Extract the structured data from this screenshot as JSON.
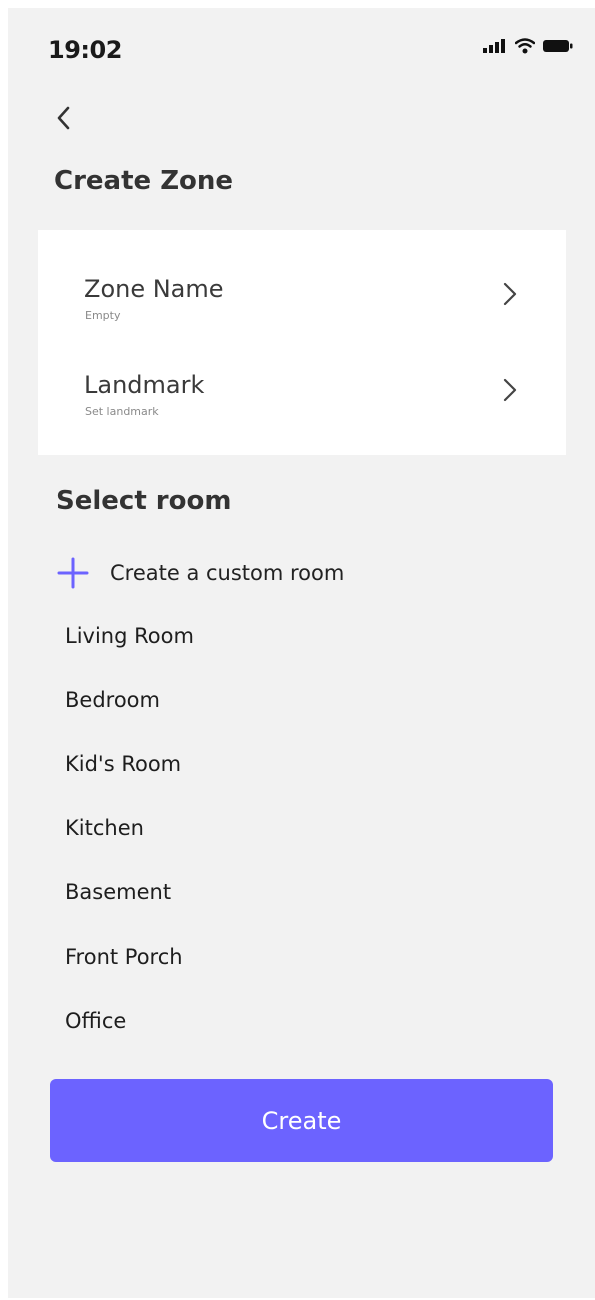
{
  "status_bar": {
    "time": "19:02",
    "icons": [
      "signal-icon",
      "wifi-icon",
      "battery-icon"
    ]
  },
  "header": {
    "back_icon": "chevron-left-icon",
    "title": "Create Zone"
  },
  "form": {
    "rows": [
      {
        "label": "Zone Name",
        "value": "Empty",
        "icon": "chevron-right-icon"
      },
      {
        "label": "Landmark",
        "value": "Set landmark",
        "icon": "chevron-right-icon"
      }
    ]
  },
  "rooms": {
    "title": "Select room",
    "custom_label": "Create a custom room",
    "custom_icon": "plus-icon",
    "items": [
      "Living Room",
      "Bedroom",
      "Kid's Room",
      "Kitchen",
      "Basement",
      "Front Porch",
      "Office"
    ]
  },
  "actions": {
    "create_label": "Create"
  },
  "colors": {
    "accent": "#6c63ff",
    "background": "#f2f2f2",
    "card": "#ffffff"
  }
}
